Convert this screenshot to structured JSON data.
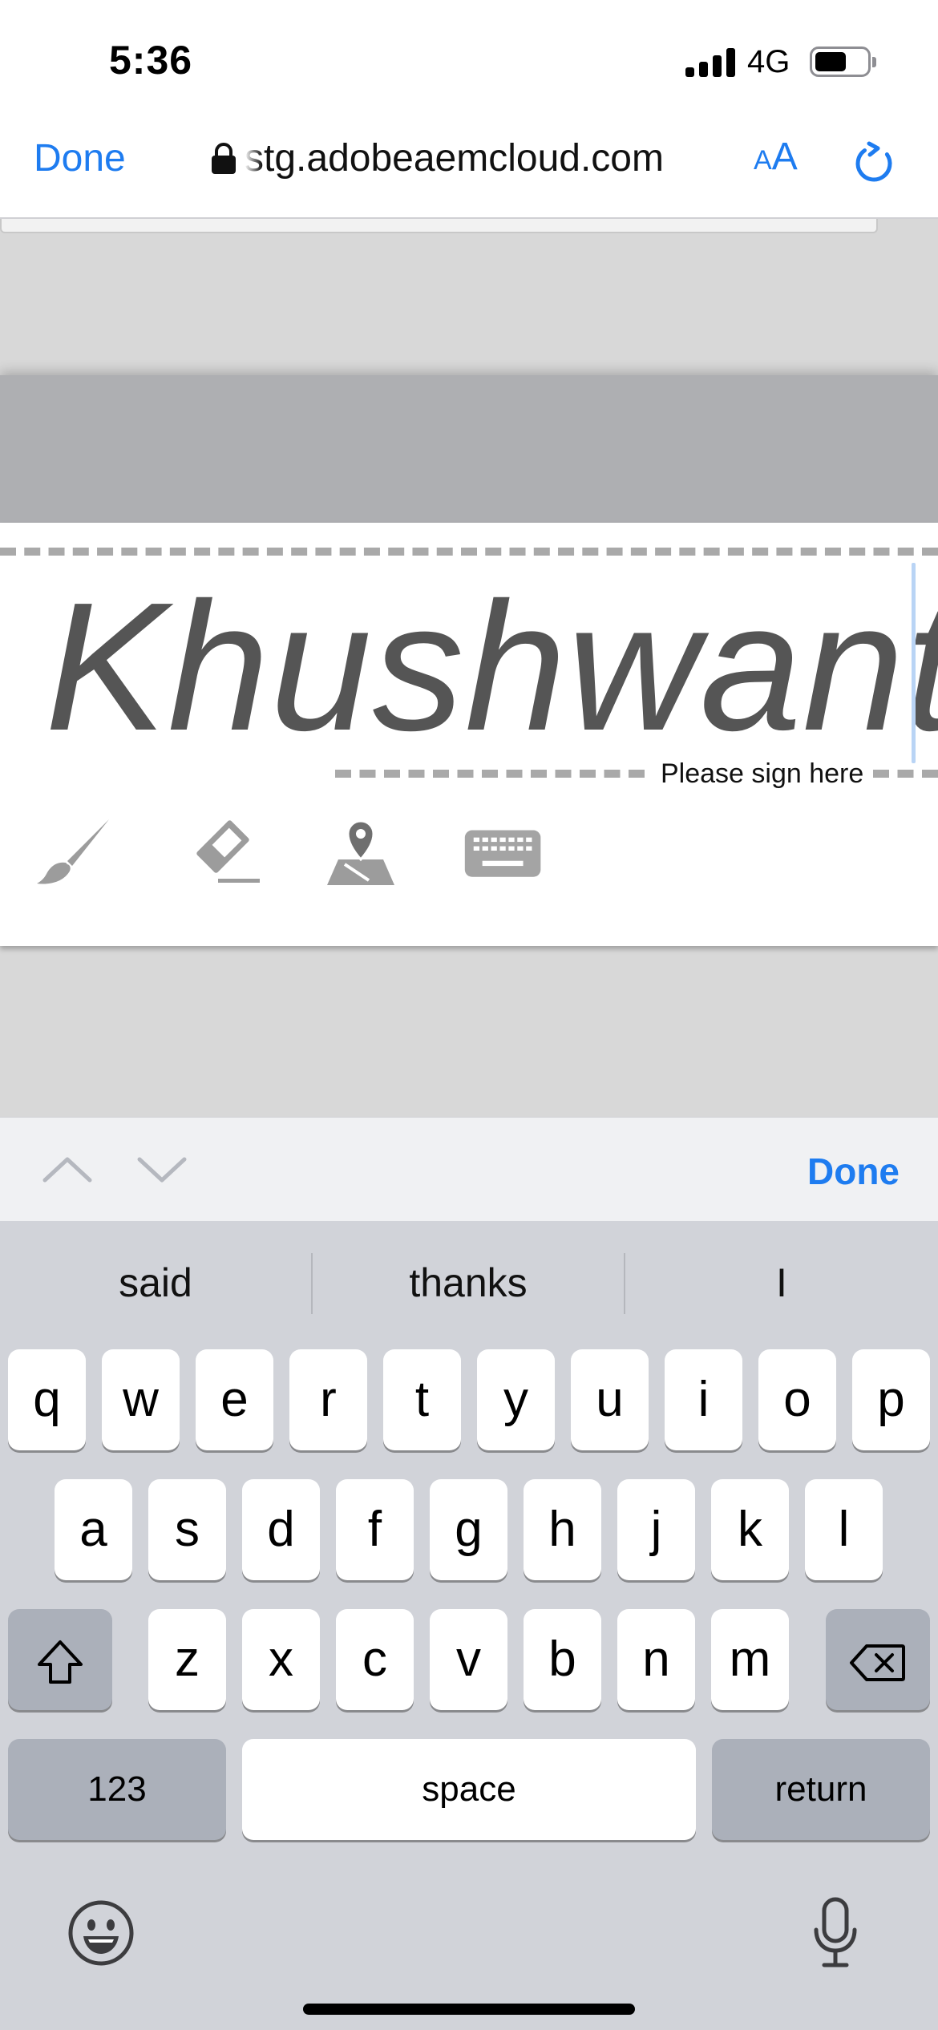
{
  "status_bar": {
    "time": "5:36",
    "network": "4G",
    "signal_bars": 4,
    "battery_level": 0.6
  },
  "browser": {
    "done_label": "Done",
    "url": "stg.adobeaemcloud.com",
    "text_size_small": "A",
    "text_size_large": "A",
    "lock_icon": "lock-icon",
    "reload_icon": "reload-icon"
  },
  "signature": {
    "typed_name": "Khushwant",
    "hint": "Please sign here",
    "tools": [
      {
        "name": "brush-icon"
      },
      {
        "name": "eraser-icon"
      },
      {
        "name": "geolocation-icon"
      },
      {
        "name": "keyboard-icon"
      }
    ]
  },
  "accessory": {
    "prev_icon": "chevron-up-icon",
    "next_icon": "chevron-down-icon",
    "done_label": "Done"
  },
  "keyboard": {
    "suggestions": [
      "said",
      "thanks",
      "I"
    ],
    "row1": [
      "q",
      "w",
      "e",
      "r",
      "t",
      "y",
      "u",
      "i",
      "o",
      "p"
    ],
    "row2": [
      "a",
      "s",
      "d",
      "f",
      "g",
      "h",
      "j",
      "k",
      "l"
    ],
    "row3": [
      "z",
      "x",
      "c",
      "v",
      "b",
      "n",
      "m"
    ],
    "numbers_label": "123",
    "space_label": "space",
    "return_label": "return",
    "shift_icon": "shift-icon",
    "delete_icon": "delete-icon",
    "emoji_icon": "emoji-icon",
    "mic_icon": "microphone-icon"
  },
  "colors": {
    "accent": "#1e7cf0",
    "signature_text": "#555555",
    "keyboard_bg": "#d1d3d9"
  }
}
